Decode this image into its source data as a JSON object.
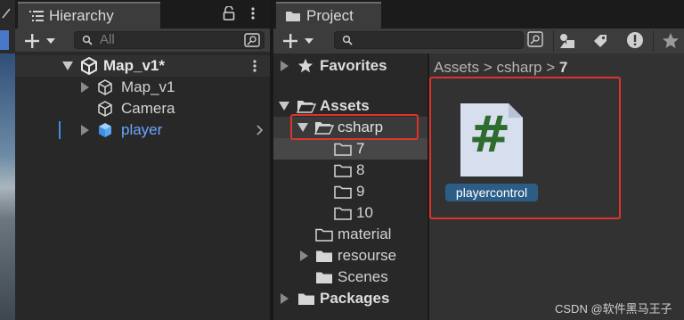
{
  "hierarchy": {
    "tab_label": "Hierarchy",
    "search_placeholder": "All",
    "scene": {
      "label": "Map_v1*"
    },
    "items": [
      {
        "label": "Map_v1"
      },
      {
        "label": "Camera"
      },
      {
        "label": "player"
      }
    ]
  },
  "project": {
    "tab_label": "Project",
    "favorites_label": "Favorites",
    "assets_label": "Assets",
    "csharp_label": "csharp",
    "subfolders": [
      "7",
      "8",
      "9",
      "10"
    ],
    "folders": [
      "material",
      "resourse",
      "Scenes"
    ],
    "packages_label": "Packages",
    "breadcrumb": {
      "part1": "Assets",
      "sep1": ">",
      "part2": "csharp",
      "sep2": ">",
      "part3": "7"
    },
    "asset": {
      "icon_glyph": "#",
      "label": "playercontrol"
    }
  },
  "watermark": "CSDN @软件黑马王子",
  "colors": {
    "accent_blue": "#6aa6ff",
    "selection_blue": "#2c5d87",
    "highlight_red": "#e0322d",
    "script_green": "#2e6b2e"
  }
}
